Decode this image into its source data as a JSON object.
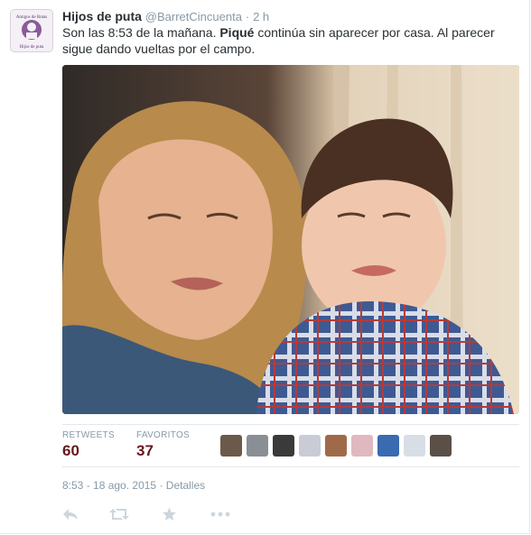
{
  "tweet": {
    "fullname": "Hijos de puta",
    "username": "@BarretCincuenta",
    "separator": "·",
    "time": "2 h",
    "text_before": "Son las 8:53 de la mañana. ",
    "text_bold": "Piqué",
    "text_after": " continúa sin aparecer por casa. Al parecer sigue dando vueltas por el campo.",
    "avatar": {
      "line1": "Amigos de Rotas",
      "line2": "Hijos de puta"
    }
  },
  "stats": {
    "retweets_label": "RETWEETS",
    "retweets_value": "60",
    "favorites_label": "FAVORITOS",
    "favorites_value": "37",
    "value_color": "#66181c"
  },
  "favoriters": [
    "avatar-1",
    "avatar-2",
    "avatar-3",
    "avatar-4",
    "avatar-5",
    "avatar-6",
    "avatar-7",
    "avatar-8",
    "avatar-9"
  ],
  "meta": {
    "timestamp": "8:53 - 18 ago. 2015",
    "separator": "·",
    "details": "Detalles"
  },
  "actions": [
    "reply-icon",
    "retweet-icon",
    "favorite-icon",
    "more-icon"
  ]
}
